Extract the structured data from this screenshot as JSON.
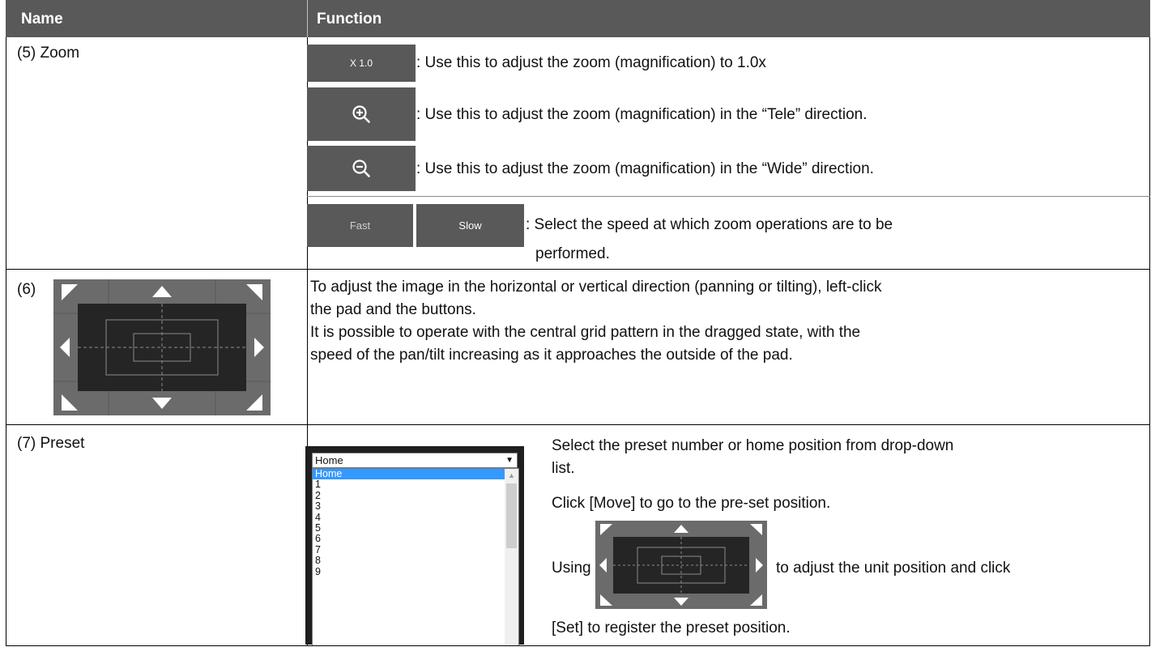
{
  "header": {
    "name": "Name",
    "function": "Function"
  },
  "rows": {
    "zoom": {
      "name": "(5)  Zoom",
      "x10_label": "X 1.0",
      "x10_desc": ": Use this to adjust the zoom (magnification) to 1.0x",
      "tele_icon": "zoom-in-icon",
      "tele_desc": ": Use this to adjust the zoom (magnification) in the “Tele” direction.",
      "wide_icon": "zoom-out-icon",
      "wide_desc": ": Use this to adjust the zoom (magnification) in the “Wide” direction.",
      "fast_label": "Fast",
      "slow_label": "Slow",
      "speed_desc_1": ": Select the speed at which zoom operations are to be",
      "speed_desc_2": "performed."
    },
    "pantilt": {
      "name": "(6)",
      "desc_1": "To adjust the image in the horizontal or vertical direction (panning or tilting), left-click",
      "desc_2": "the pad and the buttons.",
      "desc_3": "It is possible to operate with the central grid pattern in the dragged state, with the",
      "desc_4": "speed of the pan/tilt increasing as it approaches the outside of the pad."
    },
    "preset": {
      "name": "(7)  Preset",
      "selected": "Home",
      "options": [
        "Home",
        "1",
        "2",
        "3",
        "4",
        "5",
        "6",
        "7",
        "8",
        "9"
      ],
      "desc_1": "Select the preset number or home position from drop-down",
      "desc_2": "list.",
      "desc_3": "Click [Move] to go to the pre-set position.",
      "desc_4a": "Using",
      "desc_4b": "to adjust the unit position and click",
      "desc_5": "[Set] to register the preset position."
    }
  },
  "colors": {
    "header_bg": "#595959",
    "button_bg": "#595959",
    "pad_bg": "#6b6b6b",
    "highlight": "#3399ff"
  }
}
